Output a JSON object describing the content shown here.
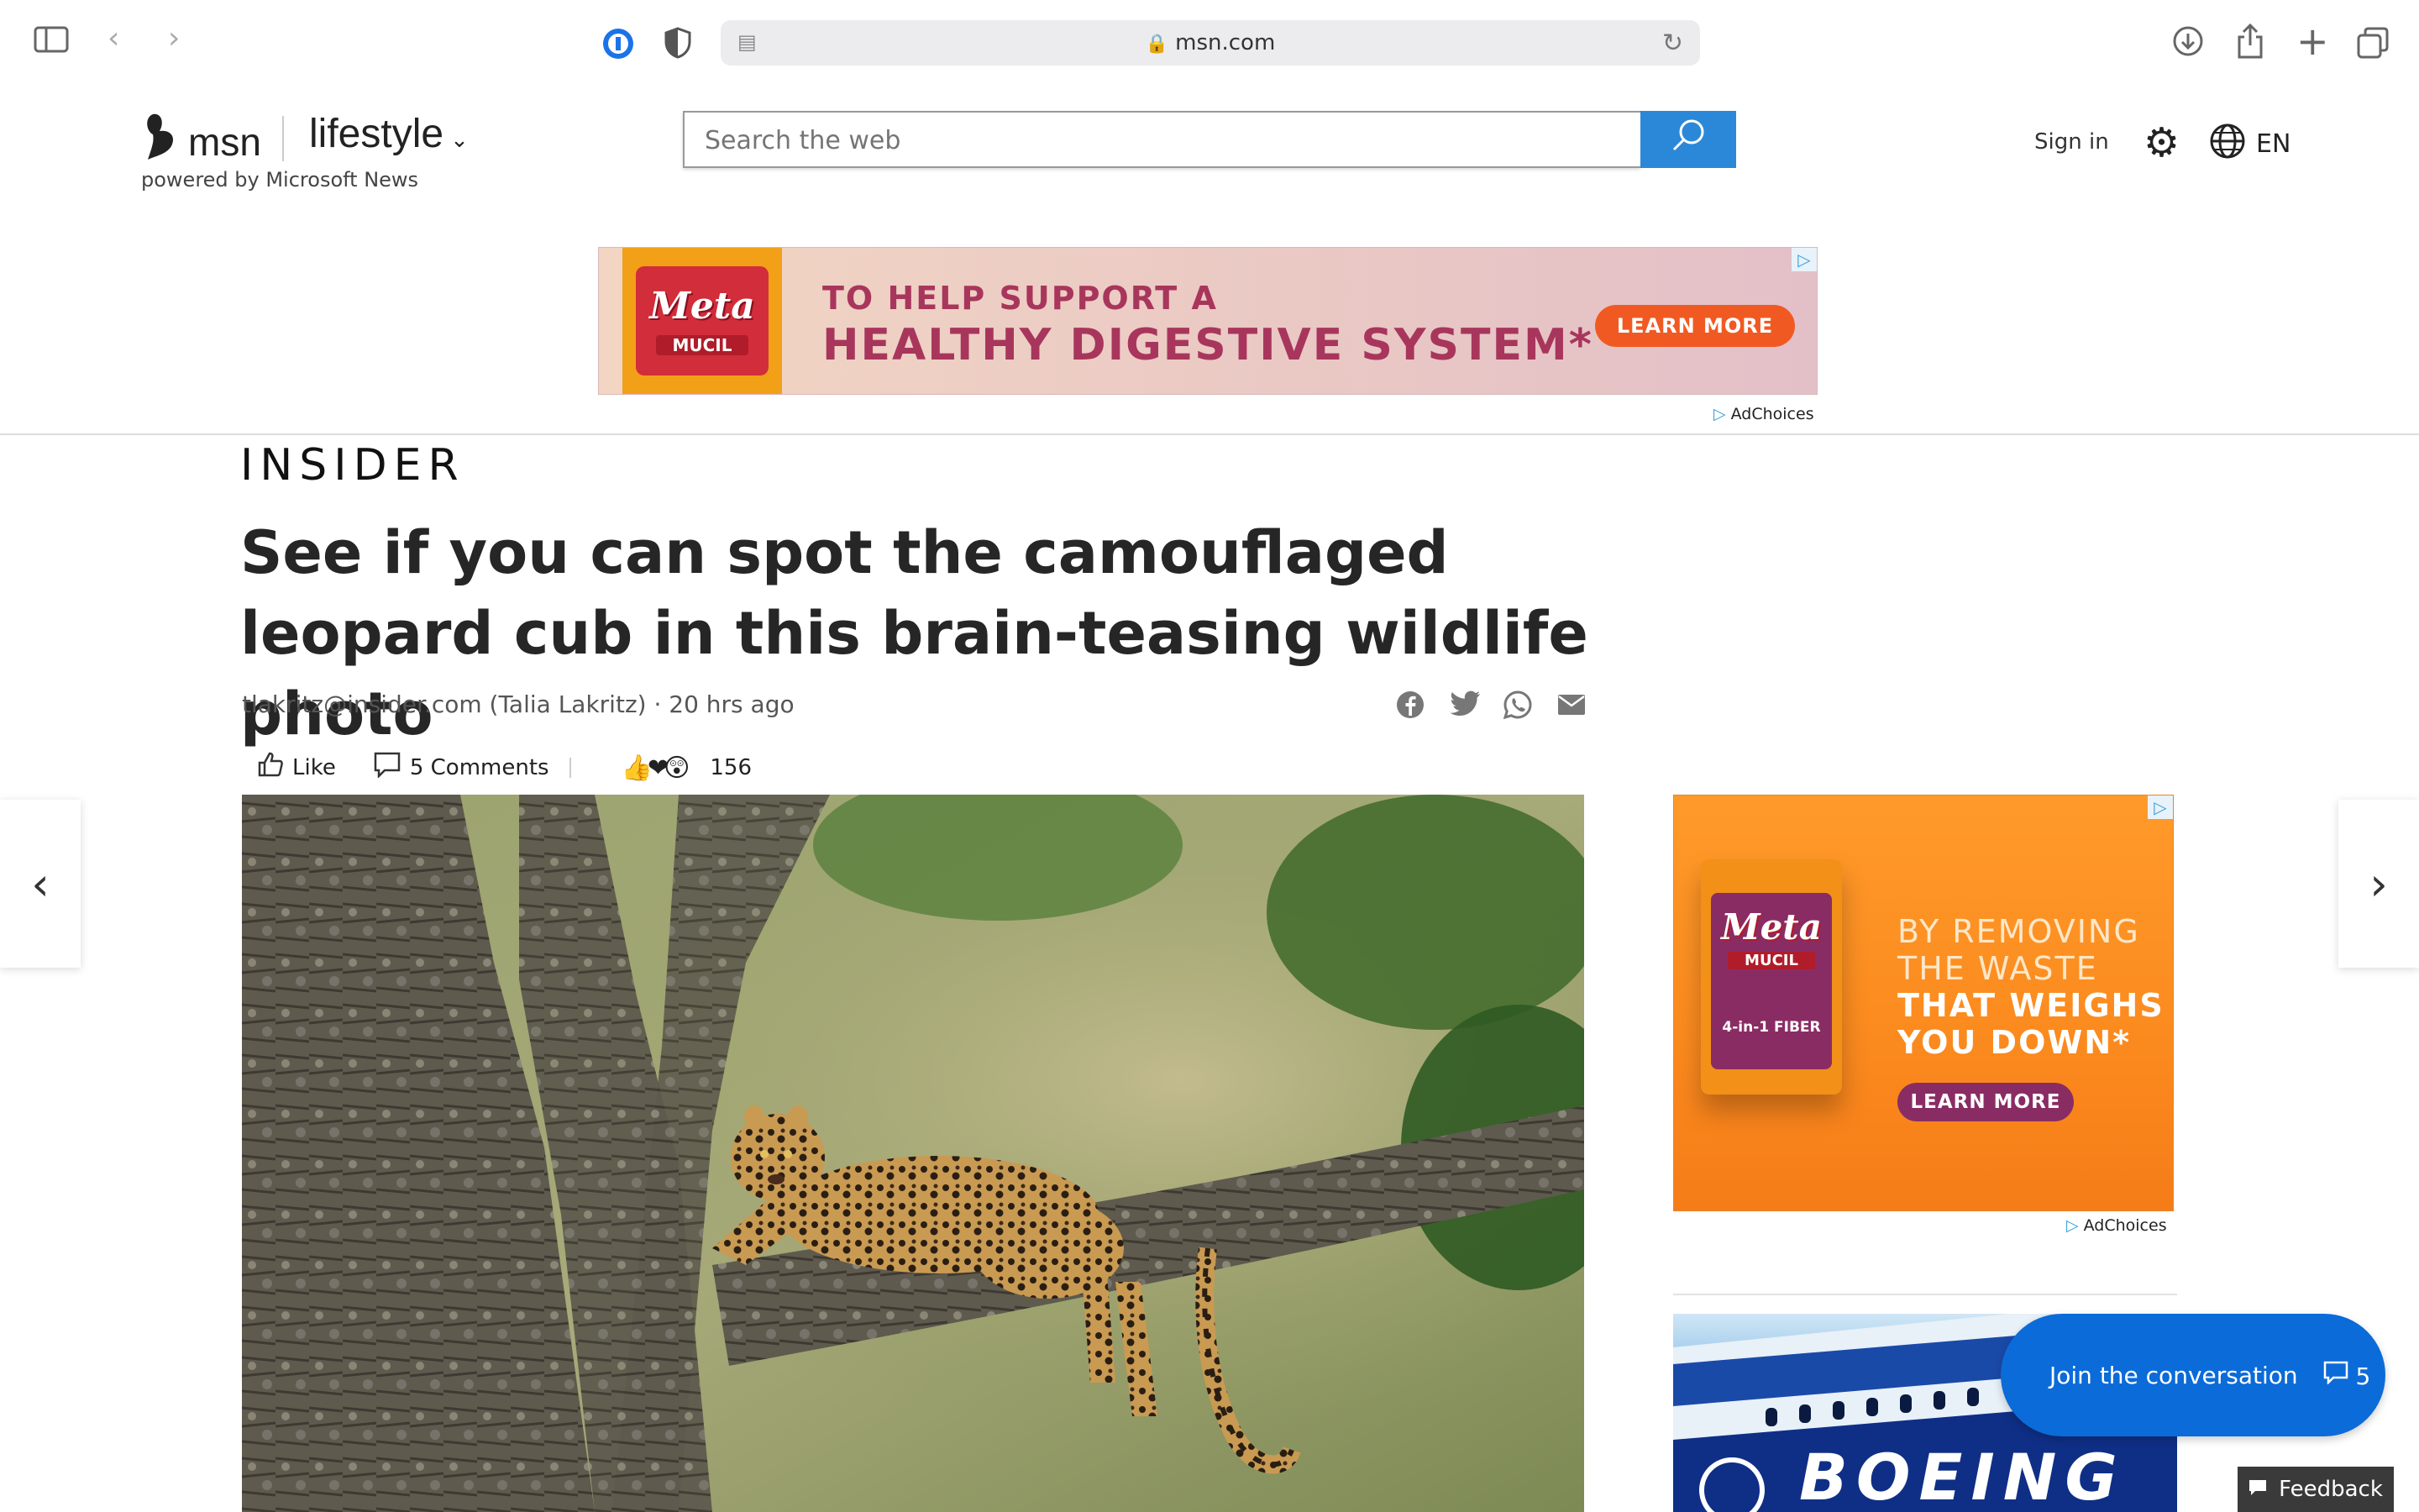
{
  "browser": {
    "url": "msn.com"
  },
  "header": {
    "brand": "msn",
    "section": "lifestyle",
    "powered_by": "powered by Microsoft News",
    "search_placeholder": "Search the web",
    "sign_in": "Sign in",
    "language": "EN"
  },
  "top_ad": {
    "brand": "Meta",
    "brand_sub": "MUCIL",
    "line1": "TO HELP SUPPORT A",
    "line2": "HEALTHY DIGESTIVE SYSTEM*",
    "cta": "LEARN MORE",
    "adchoices": "AdChoices"
  },
  "article": {
    "publisher": "INSIDER",
    "headline": "See if you can spot the camouflaged leopard cub in this brain-teasing wildlife photo",
    "byline": "tlakritz@insider.com (Talia Lakritz) · 20 hrs ago",
    "like_label": "Like",
    "comments_label": "5 Comments",
    "reaction_count": "156"
  },
  "right_ad": {
    "brand": "Meta",
    "brand_sub": "MUCIL",
    "fiber": "4-in-1 FIBER",
    "line1": "BY REMOVING",
    "line2": "THE WASTE",
    "line3": "THAT WEIGHS",
    "line4": "YOU DOWN*",
    "cta": "LEARN MORE",
    "adchoices": "AdChoices"
  },
  "promo": {
    "word": "BOEING"
  },
  "conversation": {
    "label": "Join the conversation",
    "count": "5"
  },
  "feedback": {
    "label": "Feedback"
  },
  "colors": {
    "accent": "#2b88d8",
    "join": "#0b6bd8",
    "ad_orange": "#fb8a1e",
    "ad_text": "#a8365c"
  }
}
